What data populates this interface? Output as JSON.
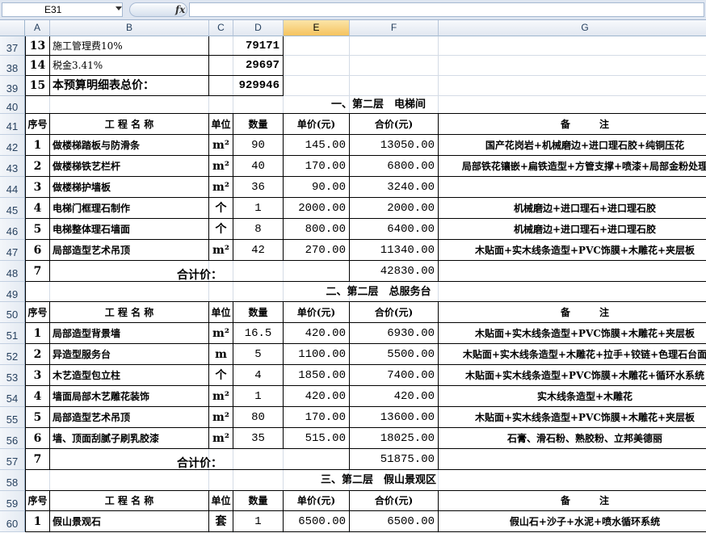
{
  "name_box": "E31",
  "fx_label": "fx",
  "columns": [
    "A",
    "B",
    "C",
    "D",
    "E",
    "F",
    "G"
  ],
  "active_column": "E",
  "top_rows": [
    {
      "row": "37",
      "idx": "13",
      "item": "施工管理费10%",
      "total": "79171"
    },
    {
      "row": "38",
      "idx": "14",
      "item": "税金3.41%",
      "total": "29697"
    },
    {
      "row": "39",
      "idx": "15",
      "item": "本预算明细表总价：",
      "total": "929946"
    }
  ],
  "header_labels": {
    "no": "序号",
    "name": "工 程 名 称",
    "unit": "单位",
    "qty": "数量",
    "price": "单价(元)",
    "amount": "合价(元)",
    "note": "备　　　注"
  },
  "sections": [
    {
      "title_row": "40",
      "title": "一、第二层　电梯间",
      "header_row": "41",
      "items": [
        {
          "row": "42",
          "no": "1",
          "name": "做楼梯踏板与防滑条",
          "unit": "m²",
          "qty": "90",
          "price": "145.00",
          "amount": "13050.00",
          "note": "国产花岗岩+机械磨边+进口理石胶+纯铜压花"
        },
        {
          "row": "43",
          "no": "2",
          "name": "做楼梯铁艺栏杆",
          "unit": "m²",
          "qty": "40",
          "price": "170.00",
          "amount": "6800.00",
          "note": "局部铁花镶嵌+扁铁造型+方管支撑+喷漆+局部金粉处理"
        },
        {
          "row": "44",
          "no": "3",
          "name": "做楼梯护墙板",
          "unit": "m²",
          "qty": "36",
          "price": "90.00",
          "amount": "3240.00",
          "note": ""
        },
        {
          "row": "45",
          "no": "4",
          "name": "电梯门框理石制作",
          "unit": "个",
          "qty": "1",
          "price": "2000.00",
          "amount": "2000.00",
          "note": "机械磨边+进口理石+进口理石胶"
        },
        {
          "row": "46",
          "no": "5",
          "name": "电梯整体理石墙面",
          "unit": "个",
          "qty": "8",
          "price": "800.00",
          "amount": "6400.00",
          "note": "机械磨边+进口理石+进口理石胶"
        },
        {
          "row": "47",
          "no": "6",
          "name": "局部造型艺术吊顶",
          "unit": "m²",
          "qty": "42",
          "price": "270.00",
          "amount": "11340.00",
          "note": "木贴面+实木线条造型+PVC饰膜+木雕花+夹层板"
        }
      ],
      "total_row": "48",
      "total_no": "7",
      "total_label": "合计价：",
      "total_amount": "42830.00"
    },
    {
      "title_row": "49",
      "title": "二、第二层　总服务台",
      "header_row": "50",
      "items": [
        {
          "row": "51",
          "no": "1",
          "name": "局部造型背景墙",
          "unit": "m²",
          "qty": "16.5",
          "price": "420.00",
          "amount": "6930.00",
          "note": "木贴面+实木线条造型+PVC饰膜+木雕花+夹层板"
        },
        {
          "row": "52",
          "no": "2",
          "name": "异造型服务台",
          "unit": "m",
          "qty": "5",
          "price": "1100.00",
          "amount": "5500.00",
          "note": "木贴面+实木线条造型+木雕花+拉手+铰链+色理石台面"
        },
        {
          "row": "53",
          "no": "3",
          "name": "木艺造型包立柱",
          "unit": "个",
          "qty": "4",
          "price": "1850.00",
          "amount": "7400.00",
          "note": "木贴面+实木线条造型+PVC饰膜+木雕花+循环水系统"
        },
        {
          "row": "54",
          "no": "4",
          "name": "墙面局部木艺雕花装饰",
          "unit": "m²",
          "qty": "1",
          "price": "420.00",
          "amount": "420.00",
          "note": "实木线条造型+木雕花"
        },
        {
          "row": "55",
          "no": "5",
          "name": "局部造型艺术吊顶",
          "unit": "m²",
          "qty": "80",
          "price": "170.00",
          "amount": "13600.00",
          "note": "木贴面+实木线条造型+PVC饰膜+木雕花+夹层板"
        },
        {
          "row": "56",
          "no": "6",
          "name": "墙、顶面刮腻子刷乳胶漆",
          "unit": "m²",
          "qty": "35",
          "price": "515.00",
          "amount": "18025.00",
          "note": "石膏、滑石粉、熟胶粉、立邦美德丽"
        }
      ],
      "total_row": "57",
      "total_no": "7",
      "total_label": "合计价：",
      "total_amount": "51875.00"
    },
    {
      "title_row": "58",
      "title": "三、第二层　假山景观区",
      "header_row": "59",
      "items": [
        {
          "row": "60",
          "no": "1",
          "name": "假山景观石",
          "unit": "套",
          "qty": "1",
          "price": "6500.00",
          "amount": "6500.00",
          "note": "假山石+沙子+水泥+喷水循环系统"
        }
      ]
    }
  ]
}
